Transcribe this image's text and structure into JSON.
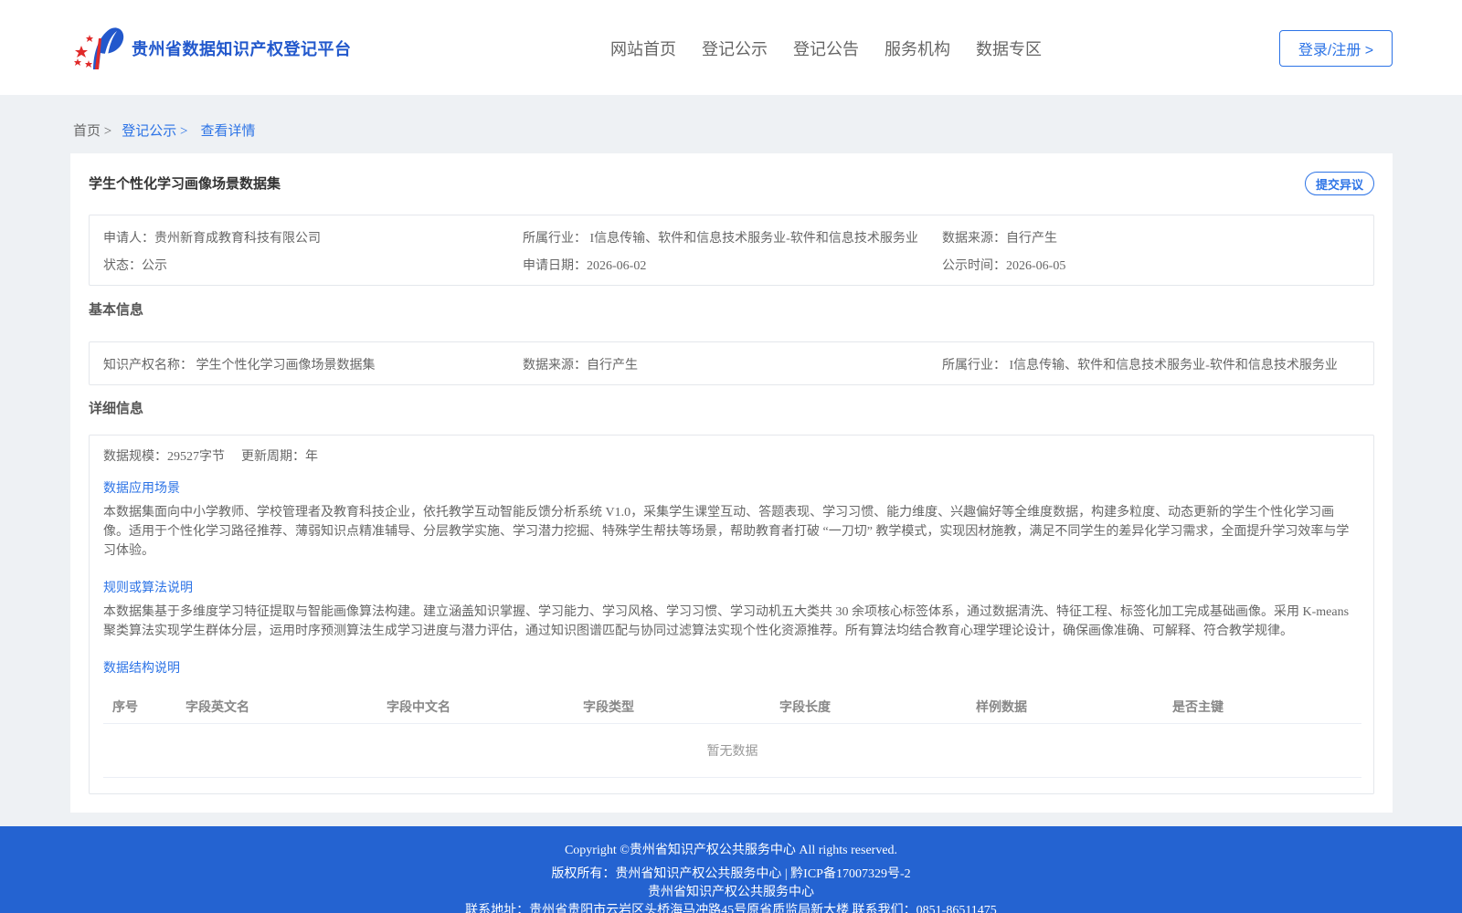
{
  "header": {
    "logo_title": "贵州省数据知识产权登记平台",
    "nav": [
      "网站首页",
      "登记公示",
      "登记公告",
      "服务机构",
      "数据专区"
    ],
    "login_label": "登录/注册 >"
  },
  "breadcrumb": {
    "home": "首页 >",
    "section": "登记公示 >",
    "current": "查看详情"
  },
  "record": {
    "title": "学生个性化学习画像场景数据集",
    "objection_label": "提交异议",
    "applicant": "申请人：贵州新育成教育科技有限公司",
    "industry": "所属行业： I信息传输、软件和信息技术服务业-软件和信息技术服务业",
    "source": "数据来源：自行产生",
    "status": "状态：公示",
    "apply_date": "申请日期：2026-06-02",
    "publish_time": "公示时间：2026-06-05"
  },
  "basic": {
    "section_title": "基本信息",
    "ip_name": "知识产权名称： 学生个性化学习画像场景数据集",
    "source": "数据来源：自行产生",
    "industry": "所属行业： I信息传输、软件和信息技术服务业-软件和信息技术服务业"
  },
  "detail": {
    "section_title": "详细信息",
    "scale": "数据规模：29527字节",
    "cycle": "更新周期：年",
    "scenario_title": "数据应用场景",
    "scenario_text": "本数据集面向中小学教师、学校管理者及教育科技企业，依托教学互动智能反馈分析系统 V1.0，采集学生课堂互动、答题表现、学习习惯、能力维度、兴趣偏好等全维度数据，构建多粒度、动态更新的学生个性化学习画像。适用于个性化学习路径推荐、薄弱知识点精准辅导、分层教学实施、学习潜力挖掘、特殊学生帮扶等场景，帮助教育者打破 “一刀切” 教学模式，实现因材施教，满足不同学生的差异化学习需求，全面提升学习效率与学习体验。",
    "algo_title": "规则或算法说明",
    "algo_text": "本数据集基于多维度学习特征提取与智能画像算法构建。建立涵盖知识掌握、学习能力、学习风格、学习习惯、学习动机五大类共 30 余项核心标签体系，通过数据清洗、特征工程、标签化加工完成基础画像。采用 K-means 聚类算法实现学生群体分层，运用时序预测算法生成学习进度与潜力评估，通过知识图谱匹配与协同过滤算法实现个性化资源推荐。所有算法均结合教育心理学理论设计，确保画像准确、可解释、符合教学规律。",
    "structure_title": "数据结构说明",
    "table_headers": [
      "序号",
      "字段英文名",
      "字段中文名",
      "字段类型",
      "字段长度",
      "样例数据",
      "是否主键"
    ],
    "empty_text": "暂无数据"
  },
  "footer": {
    "copyright": "Copyright ©贵州省知识产权公共服务中心 All rights reserved.",
    "owner": "版权所有：贵州省知识产权公共服务中心 | 黔ICP备17007329号-2",
    "org": "贵州省知识产权公共服务中心",
    "address": "联系地址：贵州省贵阳市云岩区头桥海马冲路45号原省质监局新大楼 联系我们：0851-86511475"
  },
  "colors": {
    "brand_blue": "#2c73e6",
    "footer_blue": "#2463d1",
    "logo_red": "#e02a2a"
  }
}
